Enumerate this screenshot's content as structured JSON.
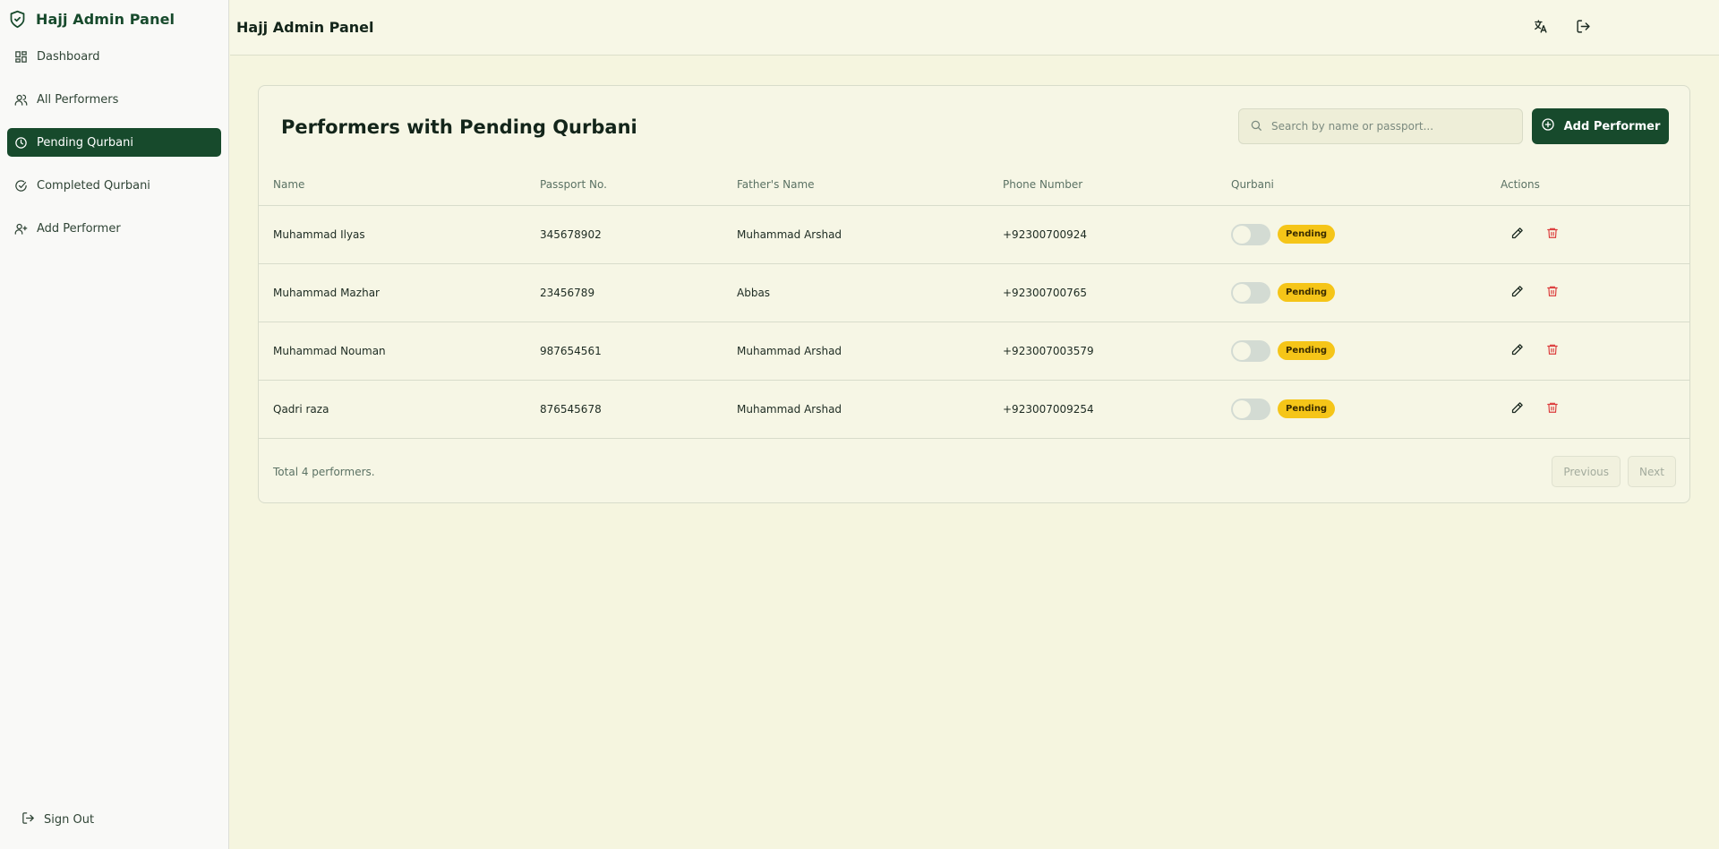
{
  "app": {
    "title": "Hajj Admin Panel"
  },
  "sidebar": {
    "items": [
      {
        "label": "Dashboard",
        "icon": "dashboard-icon",
        "active": false
      },
      {
        "label": "All Performers",
        "icon": "users-icon",
        "active": false
      },
      {
        "label": "Pending Qurbani",
        "icon": "clock-icon",
        "active": true
      },
      {
        "label": "Completed Qurbani",
        "icon": "check-circle-icon",
        "active": false
      },
      {
        "label": "Add Performer",
        "icon": "user-plus-icon",
        "active": false
      }
    ],
    "signout_label": "Sign Out"
  },
  "header": {
    "title": "Hajj Admin Panel",
    "icons": [
      "translate-icon",
      "logout-icon"
    ]
  },
  "main": {
    "title": "Performers with Pending Qurbani",
    "search": {
      "placeholder": "Search by name or passport...",
      "value": ""
    },
    "add_button_label": "Add Performer",
    "table": {
      "columns": [
        "Name",
        "Passport No.",
        "Father's Name",
        "Phone Number",
        "Qurbani",
        "Actions"
      ],
      "rows": [
        {
          "name": "Muhammad Ilyas",
          "passport": "345678902",
          "father": "Muhammad Arshad",
          "phone": "+92300700924",
          "status": "Pending",
          "qurbani_done": false
        },
        {
          "name": "Muhammad Mazhar",
          "passport": "23456789",
          "father": "Abbas",
          "phone": "+92300700765",
          "status": "Pending",
          "qurbani_done": false
        },
        {
          "name": "Muhammad Nouman",
          "passport": "987654561",
          "father": "Muhammad Arshad",
          "phone": "+923007003579",
          "status": "Pending",
          "qurbani_done": false
        },
        {
          "name": "Qadri raza",
          "passport": "876545678",
          "father": "Muhammad Arshad",
          "phone": "+923007009254",
          "status": "Pending",
          "qurbani_done": false
        }
      ]
    },
    "footer": {
      "total_text": "Total 4 performers.",
      "previous_label": "Previous",
      "next_label": "Next"
    }
  },
  "colors": {
    "accent": "#174a2c",
    "pending": "#f5c518",
    "danger": "#dc3b3b",
    "background": "#f5f5df"
  }
}
